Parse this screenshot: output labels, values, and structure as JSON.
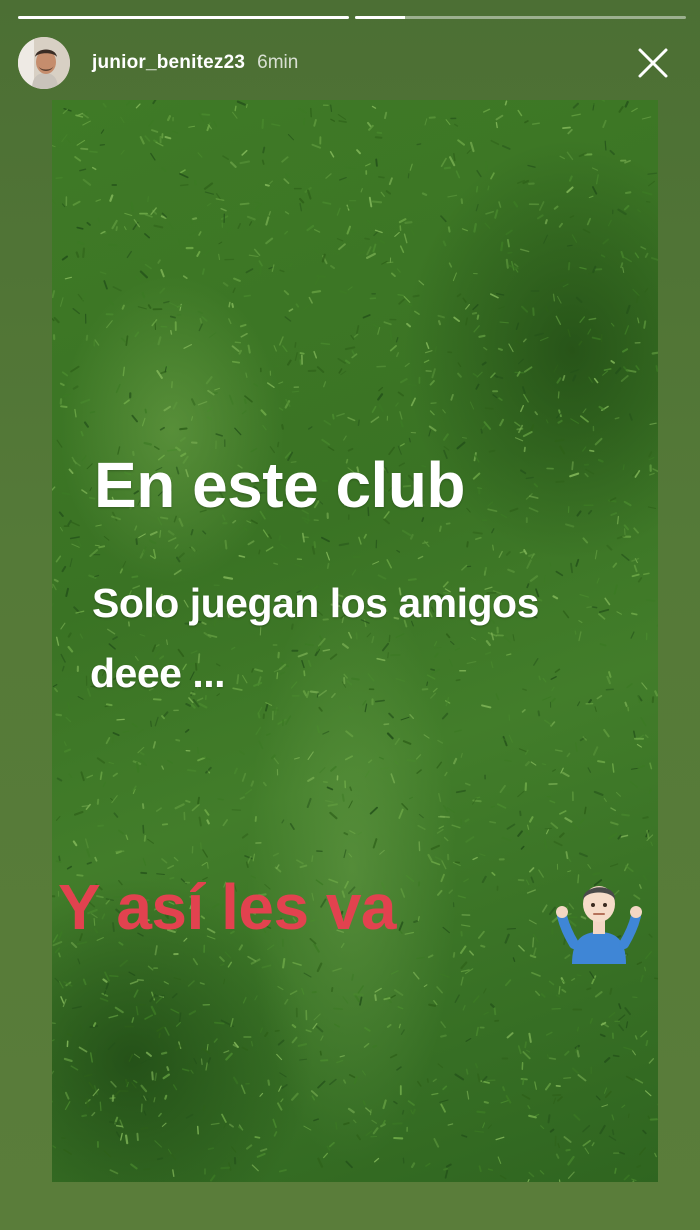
{
  "story": {
    "progress": [
      1.0,
      0.15
    ],
    "username": "junior_benitez23",
    "time": "6min",
    "close_icon": "close-icon",
    "captions": {
      "line1": "En este club",
      "line2": "Solo juegan los amigos",
      "line3": "deee ...",
      "line4": "Y así les va"
    },
    "emoji": "man-shrugging",
    "colors": {
      "background": "#557a38",
      "turf": "#3f7a26",
      "caption_text": "#ffffff",
      "highlight_text": "#e2424f"
    }
  }
}
